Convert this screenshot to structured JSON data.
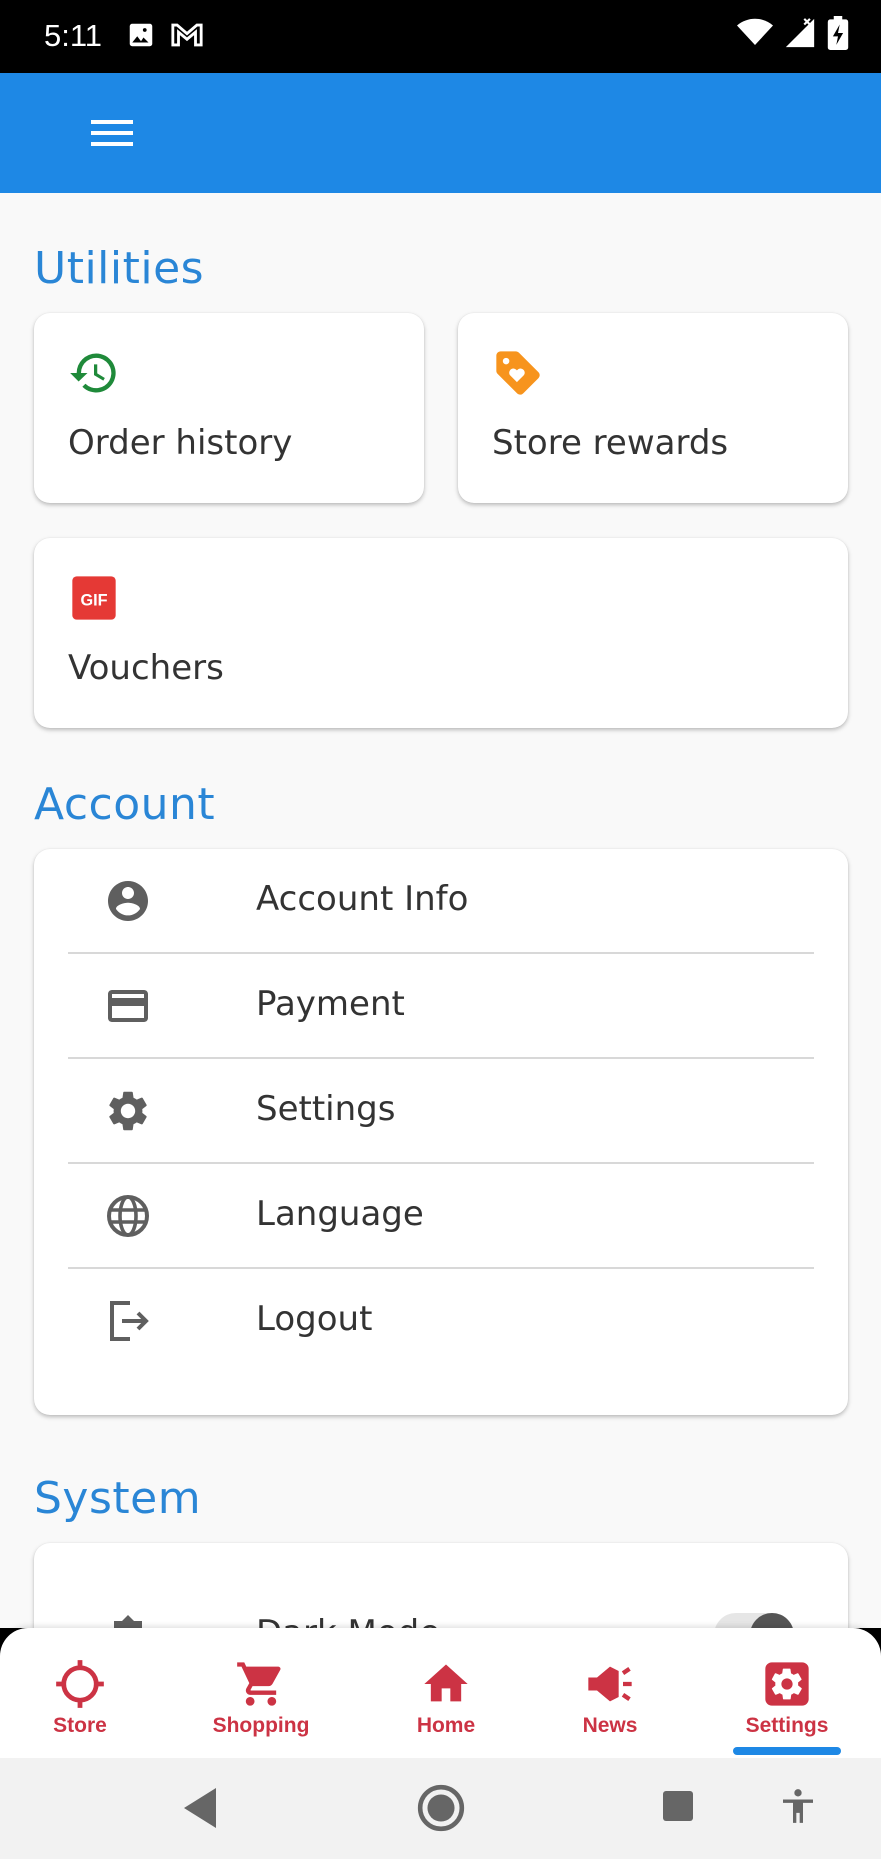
{
  "status_bar": {
    "time": "5:11"
  },
  "colors": {
    "app_bar": "#1e88e5",
    "section_title": "#2a86d6",
    "nav_accent": "#cc3344",
    "indicator": "#1e88e5"
  },
  "utilities": {
    "title": "Utilities",
    "tiles": [
      {
        "label": "Order history",
        "icon": "history-icon"
      },
      {
        "label": "Store rewards",
        "icon": "tag-heart-icon"
      },
      {
        "label": "Vouchers",
        "icon": "gif-icon",
        "icon_text": "GIF"
      }
    ]
  },
  "account": {
    "title": "Account",
    "items": [
      {
        "label": "Account Info",
        "icon": "account-circle-icon"
      },
      {
        "label": "Payment",
        "icon": "credit-card-icon"
      },
      {
        "label": "Settings",
        "icon": "gear-icon"
      },
      {
        "label": "Language",
        "icon": "globe-icon"
      },
      {
        "label": "Logout",
        "icon": "logout-icon"
      }
    ]
  },
  "system": {
    "title": "System",
    "items": [
      {
        "label": "Dark Mode",
        "icon": "brightness-icon",
        "toggle": false
      }
    ]
  },
  "bottom_nav": {
    "items": [
      {
        "label": "Store",
        "icon": "crosshair-icon"
      },
      {
        "label": "Shopping",
        "icon": "cart-icon"
      },
      {
        "label": "Home",
        "icon": "home-icon"
      },
      {
        "label": "News",
        "icon": "megaphone-icon"
      },
      {
        "label": "Settings",
        "icon": "settings-box-icon",
        "active": true
      }
    ]
  }
}
